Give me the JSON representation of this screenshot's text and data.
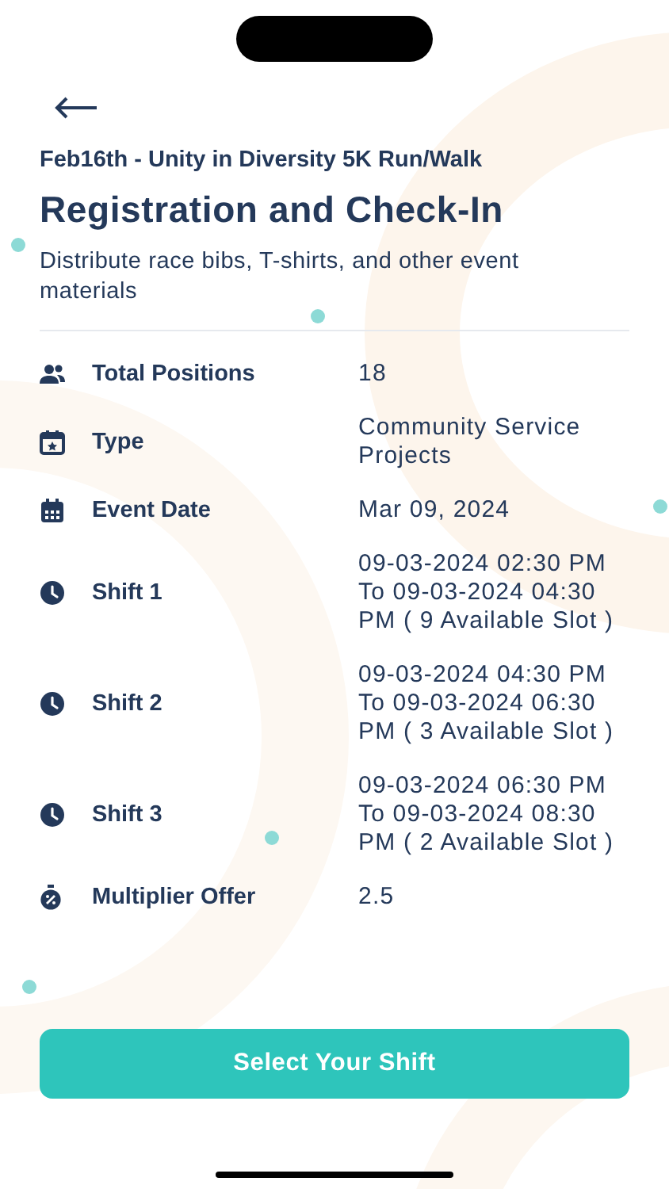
{
  "header": {
    "subtitle": "Feb16th - Unity in Diversity 5K Run/Walk",
    "title": "Registration and Check-In",
    "description": "Distribute race bibs, T-shirts, and other event materials"
  },
  "details": [
    {
      "kind": "people",
      "label": "Total Positions",
      "value": "18"
    },
    {
      "kind": "category",
      "label": "Type",
      "value": "Community Service Projects"
    },
    {
      "kind": "calendar",
      "label": "Event Date",
      "value": "Mar 09, 2024"
    },
    {
      "kind": "clock",
      "label": "Shift 1",
      "value": "09-03-2024 02:30 PM To 09-03-2024 04:30 PM ( 9 Available Slot )"
    },
    {
      "kind": "clock",
      "label": "Shift 2",
      "value": "09-03-2024 04:30 PM To 09-03-2024 06:30 PM ( 3 Available Slot )"
    },
    {
      "kind": "clock",
      "label": "Shift 3",
      "value": "09-03-2024 06:30 PM To 09-03-2024 08:30 PM ( 2 Available Slot )"
    },
    {
      "kind": "timer",
      "label": "Multiplier Offer",
      "value": "2.5"
    }
  ],
  "action": {
    "label": "Select Your Shift"
  }
}
